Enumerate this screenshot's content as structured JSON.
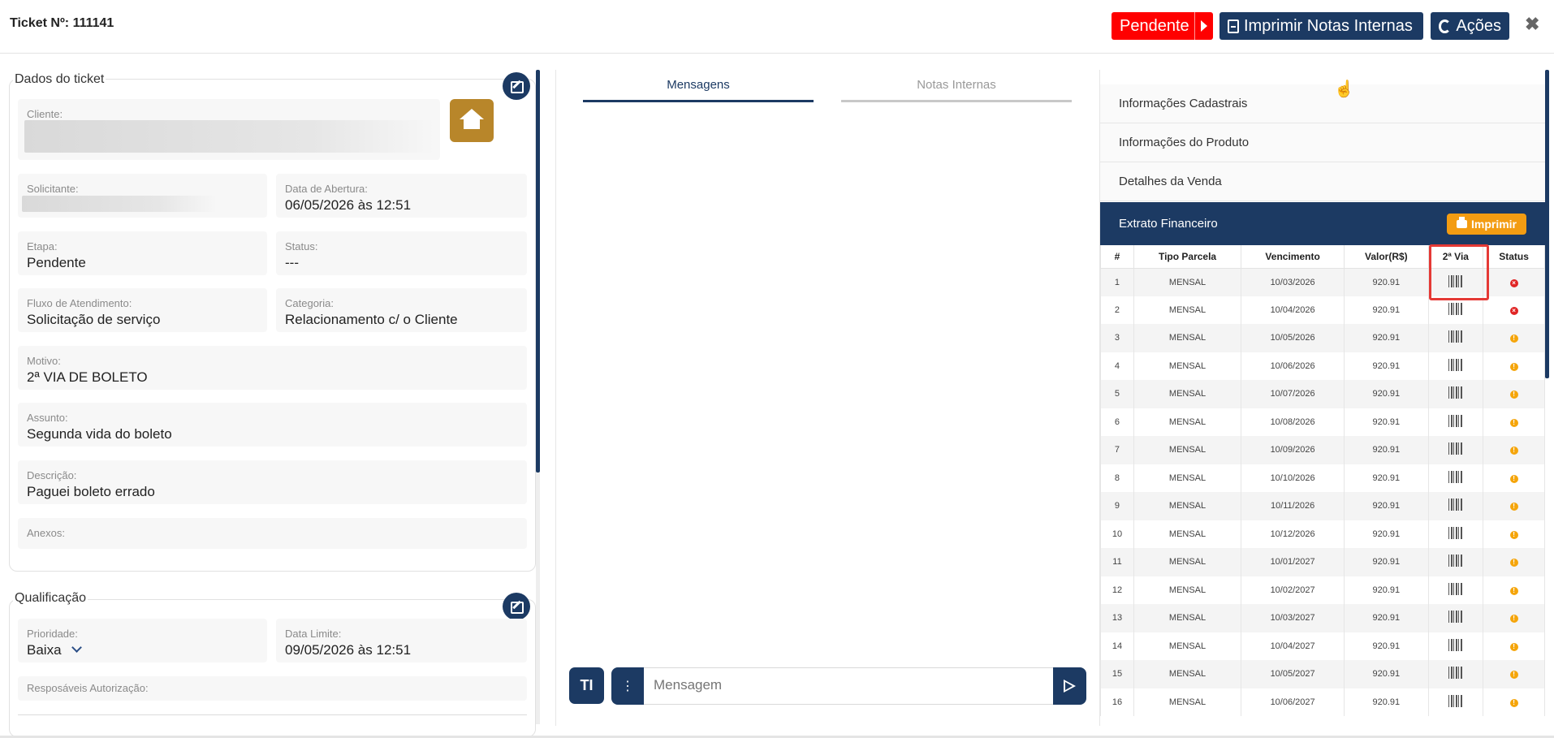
{
  "header": {
    "title": "Ticket Nº: 111141",
    "status_button": "Pendente",
    "print_notes_button": "Imprimir Notas Internas",
    "actions_button": "Ações",
    "close_symbol": "✖"
  },
  "ticket": {
    "section_title": "Dados do ticket",
    "fields": {
      "cliente_label": "Cliente:",
      "solicitante_label": "Solicitante:",
      "data_abertura_label": "Data de Abertura:",
      "data_abertura_value": "06/05/2026 às 12:51",
      "etapa_label": "Etapa:",
      "etapa_value": "Pendente",
      "status_label": "Status:",
      "status_value": "---",
      "fluxo_label": "Fluxo de Atendimento:",
      "fluxo_value": "Solicitação de serviço",
      "categoria_label": "Categoria:",
      "categoria_value": "Relacionamento c/ o Cliente",
      "motivo_label": "Motivo:",
      "motivo_value": "2ª VIA DE BOLETO",
      "assunto_label": "Assunto:",
      "assunto_value": "Segunda vida do boleto",
      "descricao_label": "Descrição:",
      "descricao_value": "Paguei boleto errado",
      "anexos_label": "Anexos:"
    }
  },
  "qualificacao": {
    "section_title": "Qualificação",
    "prioridade_label": "Prioridade:",
    "prioridade_value": "Baixa",
    "data_limite_label": "Data Limite:",
    "data_limite_value": "09/05/2026 às 12:51",
    "responsaveis_label": "Resposáveis Autorização:"
  },
  "messages": {
    "tab_mensagens": "Mensagens",
    "tab_notas": "Notas Internas",
    "input_placeholder": "Mensagem",
    "text_size_icon": "TI",
    "more_icon": "⋮"
  },
  "sidebar": {
    "items": [
      "Informações Cadastrais",
      "Informações do Produto",
      "Detalhes da Venda"
    ],
    "active_item": "Extrato Financeiro",
    "print_button": "Imprimir"
  },
  "extrato": {
    "columns": [
      "#",
      "Tipo Parcela",
      "Vencimento",
      "Valor(R$)",
      "2ª Via",
      "Status"
    ],
    "rows": [
      {
        "n": "1",
        "tipo": "MENSAL",
        "venc": "10/03/2026",
        "valor": "920.91",
        "status": "red"
      },
      {
        "n": "2",
        "tipo": "MENSAL",
        "venc": "10/04/2026",
        "valor": "920.91",
        "status": "red"
      },
      {
        "n": "3",
        "tipo": "MENSAL",
        "venc": "10/05/2026",
        "valor": "920.91",
        "status": "orange"
      },
      {
        "n": "4",
        "tipo": "MENSAL",
        "venc": "10/06/2026",
        "valor": "920.91",
        "status": "orange"
      },
      {
        "n": "5",
        "tipo": "MENSAL",
        "venc": "10/07/2026",
        "valor": "920.91",
        "status": "orange"
      },
      {
        "n": "6",
        "tipo": "MENSAL",
        "venc": "10/08/2026",
        "valor": "920.91",
        "status": "orange"
      },
      {
        "n": "7",
        "tipo": "MENSAL",
        "venc": "10/09/2026",
        "valor": "920.91",
        "status": "orange"
      },
      {
        "n": "8",
        "tipo": "MENSAL",
        "venc": "10/10/2026",
        "valor": "920.91",
        "status": "orange"
      },
      {
        "n": "9",
        "tipo": "MENSAL",
        "venc": "10/11/2026",
        "valor": "920.91",
        "status": "orange"
      },
      {
        "n": "10",
        "tipo": "MENSAL",
        "venc": "10/12/2026",
        "valor": "920.91",
        "status": "orange"
      },
      {
        "n": "11",
        "tipo": "MENSAL",
        "venc": "10/01/2027",
        "valor": "920.91",
        "status": "orange"
      },
      {
        "n": "12",
        "tipo": "MENSAL",
        "venc": "10/02/2027",
        "valor": "920.91",
        "status": "orange"
      },
      {
        "n": "13",
        "tipo": "MENSAL",
        "venc": "10/03/2027",
        "valor": "920.91",
        "status": "orange"
      },
      {
        "n": "14",
        "tipo": "MENSAL",
        "venc": "10/04/2027",
        "valor": "920.91",
        "status": "orange"
      },
      {
        "n": "15",
        "tipo": "MENSAL",
        "venc": "10/05/2027",
        "valor": "920.91",
        "status": "orange"
      },
      {
        "n": "16",
        "tipo": "MENSAL",
        "venc": "10/06/2027",
        "valor": "920.91",
        "status": "orange"
      }
    ]
  },
  "colors": {
    "primary": "#1c3a63",
    "pending_red": "#ff0000",
    "home_gold": "#b8862a",
    "print_orange": "#f39c12",
    "highlight_red": "#e53935"
  }
}
